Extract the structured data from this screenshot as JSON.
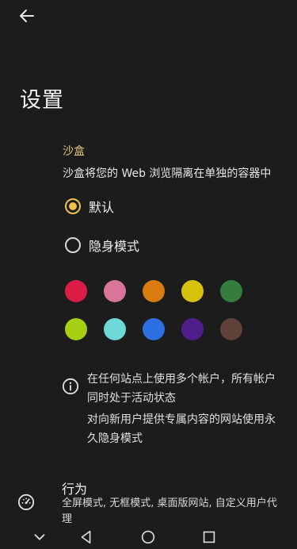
{
  "page": {
    "title": "设置"
  },
  "sandbox": {
    "label": "沙盒",
    "description": "沙盒将您的 Web 浏览隔离在单独的容器中",
    "options": [
      {
        "label": "默认",
        "selected": true
      },
      {
        "label": "隐身模式",
        "selected": false
      }
    ],
    "colors": [
      "#dc1e47",
      "#d9749a",
      "#d97b0e",
      "#d6c20b",
      "#347d3e",
      "#a6cf12",
      "#6ed7d8",
      "#2c6fe0",
      "#4f1e8b",
      "#5f4139"
    ],
    "info_text_1": "在任何站点上使用多个帐户，所有帐户同时处于活动状态",
    "info_text_2": "对向新用户提供专属内容的网站使用永久隐身模式"
  },
  "behavior": {
    "title": "行为",
    "subtitle": "全屏模式, 无框模式, 桌面版网站, 自定义用户代理"
  },
  "icons": {
    "back": "back-arrow-icon",
    "info": "info-icon",
    "behavior": "speedometer-icon",
    "nav_down": "chevron-down-icon",
    "nav_back": "nav-back-icon",
    "nav_home": "nav-home-icon",
    "nav_recents": "nav-recents-icon"
  }
}
